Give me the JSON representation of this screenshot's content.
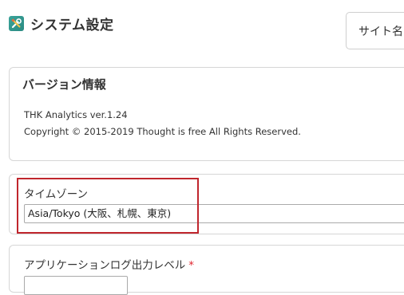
{
  "header": {
    "title": "システム設定",
    "icon": "tools-icon",
    "icon_color": "#2e9a8f",
    "site_button_label": "サイト名"
  },
  "version_info": {
    "title": "バージョン情報",
    "version_text": "THK Analytics ver.1.24",
    "copyright_text": "Copyright © 2015-2019 Thought is free All Rights Reserved."
  },
  "timezone": {
    "label": "タイムゾーン",
    "selected_value": "Asia/Tokyo (大阪、札幌、東京)"
  },
  "log_level": {
    "label": "アプリケーションログ出力レベル",
    "required_mark": "*",
    "required_color": "#e0262f"
  },
  "highlight": {
    "color": "#c0262d"
  }
}
